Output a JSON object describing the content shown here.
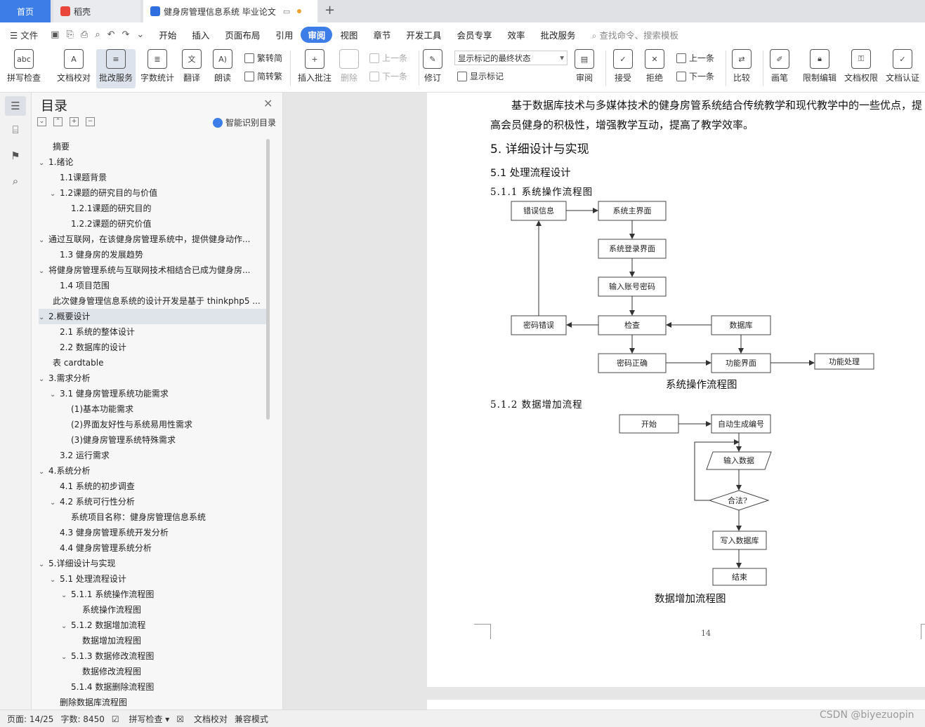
{
  "tabs": {
    "home": "首页",
    "daoke": "稻壳",
    "doc": "健身房管理信息系统 毕业论文"
  },
  "menu": {
    "file": "文件",
    "items": [
      "开始",
      "插入",
      "页面布局",
      "引用",
      "审阅",
      "视图",
      "章节",
      "开发工具",
      "会员专享",
      "效率",
      "批改服务"
    ],
    "search": "查找命令、搜索模板"
  },
  "ribbon": {
    "spell": "拼写检查",
    "doccheck": "文档校对",
    "revise": "批改服务",
    "wordcount": "字数统计",
    "translate": "翻译",
    "read": "朗读",
    "t2s": "繁转简",
    "s2t": "简转繁",
    "insert_comment": "插入批注",
    "delete": "删除",
    "prev": "上一条",
    "next": "下一条",
    "track": "修订",
    "combo": "显示标记的最终状态",
    "show_marks": "显示标记",
    "review": "审阅",
    "accept": "接受",
    "reject": "拒绝",
    "prev2": "上一条",
    "next2": "下一条",
    "compare": "比较",
    "pen": "画笔",
    "restrict": "限制编辑",
    "perm": "文档权限",
    "cert": "文档认证"
  },
  "toc": {
    "title": "目录",
    "smart": "智能识别目录",
    "items": [
      {
        "t": "摘要",
        "l": 1,
        "c": ""
      },
      {
        "t": "1.绪论",
        "l": 1,
        "c": "v"
      },
      {
        "t": "1.1课题背景",
        "l": 2,
        "c": ""
      },
      {
        "t": "1.2课题的研究目的与价值",
        "l": 2,
        "c": "v"
      },
      {
        "t": "1.2.1课题的研究目的",
        "l": 3,
        "c": ""
      },
      {
        "t": "1.2.2课题的研究价值",
        "l": 3,
        "c": ""
      },
      {
        "t": "通过互联网，在该健身房管理系统中，提供健身动作...",
        "l": 1,
        "c": "v"
      },
      {
        "t": "1.3  健身房的发展趋势",
        "l": 2,
        "c": ""
      },
      {
        "t": "将健身房管理系统与互联网技术相结合已成为健身房...",
        "l": 1,
        "c": "v"
      },
      {
        "t": "1.4 项目范围",
        "l": 2,
        "c": ""
      },
      {
        "t": "此次健身管理信息系统的设计开发是基于 thinkphp5 ...",
        "l": 1,
        "c": ""
      },
      {
        "t": "2.概要设计",
        "l": 1,
        "c": "v",
        "sel": true
      },
      {
        "t": "2.1  系统的整体设计",
        "l": 2,
        "c": ""
      },
      {
        "t": "2.2  数据库的设计",
        "l": 2,
        "c": ""
      },
      {
        "t": "表 cardtable",
        "l": 1,
        "c": ""
      },
      {
        "t": "3.需求分析",
        "l": 1,
        "c": "v"
      },
      {
        "t": "3.1  健身房管理系统功能需求",
        "l": 2,
        "c": "v"
      },
      {
        "t": "(1)基本功能需求",
        "l": 3,
        "c": ""
      },
      {
        "t": "(2)界面友好性与系统易用性需求",
        "l": 3,
        "c": ""
      },
      {
        "t": "(3)健身房管理系统特殊需求",
        "l": 3,
        "c": ""
      },
      {
        "t": "3.2  运行需求",
        "l": 2,
        "c": ""
      },
      {
        "t": "4.系统分析",
        "l": 1,
        "c": "v"
      },
      {
        "t": "4.1  系统的初步调查",
        "l": 2,
        "c": ""
      },
      {
        "t": "4.2  系统可行性分析",
        "l": 2,
        "c": "v"
      },
      {
        "t": "系统项目名称：健身房管理信息系统",
        "l": 3,
        "c": ""
      },
      {
        "t": "4.3  健身房管理系统开发分析",
        "l": 2,
        "c": ""
      },
      {
        "t": "4.4 健身房管理系统分析",
        "l": 2,
        "c": ""
      },
      {
        "t": "5.详细设计与实现",
        "l": 1,
        "c": "v"
      },
      {
        "t": "5.1  处理流程设计",
        "l": 2,
        "c": "v"
      },
      {
        "t": "5.1.1  系统操作流程图",
        "l": 3,
        "c": "v"
      },
      {
        "t": "系统操作流程图",
        "l": 4,
        "c": ""
      },
      {
        "t": "5.1.2  数据增加流程",
        "l": 3,
        "c": "v"
      },
      {
        "t": "数据增加流程图",
        "l": 4,
        "c": ""
      },
      {
        "t": "5.1.3  数据修改流程图",
        "l": 3,
        "c": "v"
      },
      {
        "t": "数据修改流程图",
        "l": 4,
        "c": ""
      },
      {
        "t": "5.1.4  数据删除流程图",
        "l": 3,
        "c": ""
      },
      {
        "t": "删除数据库流程图",
        "l": 2,
        "c": ""
      }
    ]
  },
  "doc": {
    "para": "基于数据库技术与多媒体技术的健身房管系统结合传统教学和现代教学中的一些优点，提高会员健身的积极性，增强教学互动，提高了教学效率。",
    "h1": "5. 详细设计与实现",
    "h2": "5.1  处理流程设计",
    "h3a": "5.1.1  系统操作流程图",
    "h3b": "5.1.2  数据增加流程",
    "cap1": "系统操作流程图",
    "cap2": "数据增加流程图",
    "page_no": "14",
    "fc1": {
      "err_info": "错误信息",
      "main": "系统主界面",
      "login": "系统登录界面",
      "input": "输入账号密码",
      "pwd_err": "密码错误",
      "check": "检查",
      "db": "数据库",
      "pwd_ok": "密码正确",
      "func_ui": "功能界面",
      "func_proc": "功能处理"
    },
    "fc2": {
      "start": "开始",
      "auto": "自动生成编号",
      "input": "输入数据",
      "valid": "合法?",
      "write": "写入数据库",
      "end": "结束"
    }
  },
  "status": {
    "page": "页面: 14/25",
    "words": "字数: 8450",
    "spell": "拼写检查",
    "doccheck": "文档校对",
    "compat": "兼容模式"
  },
  "watermark": "CSDN @biyezuopin"
}
